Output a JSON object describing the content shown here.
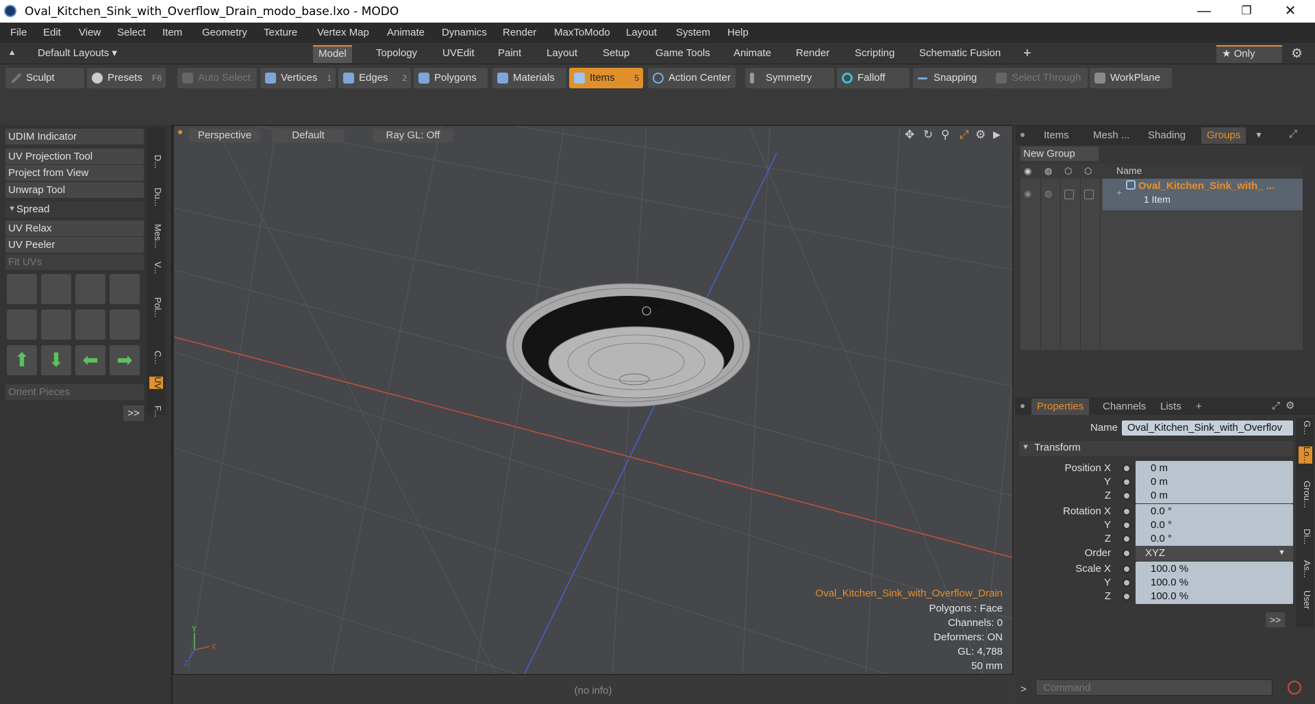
{
  "window": {
    "title": "Oval_Kitchen_Sink_with_Overflow_Drain_modo_base.lxo - MODO",
    "minimize": "—",
    "maximize": "❐",
    "close": "✕"
  },
  "menu": [
    "File",
    "Edit",
    "View",
    "Select",
    "Item",
    "Geometry",
    "Texture",
    "Vertex Map",
    "Animate",
    "Dynamics",
    "Render",
    "MaxToModo",
    "Layout",
    "System",
    "Help"
  ],
  "layout_selector": "Default Layouts ▾",
  "tabs": [
    "Model",
    "Topology",
    "UVEdit",
    "Paint",
    "Layout",
    "Setup",
    "Game Tools",
    "Animate",
    "Render",
    "Scripting",
    "Schematic Fusion"
  ],
  "tab_add": "+",
  "only_button": "★  Only",
  "toolbar": {
    "sculpt": "Sculpt",
    "presets": "Presets",
    "presets_key": "F6",
    "auto_select": "Auto Select",
    "vertices": "Vertices",
    "vertices_num": "1",
    "edges": "Edges",
    "edges_num": "2",
    "polygons": "Polygons",
    "materials": "Materials",
    "items": "Items",
    "items_num": "5",
    "action_center": "Action Center",
    "symmetry": "Symmetry",
    "falloff": "Falloff",
    "snapping": "Snapping",
    "select_through": "Select Through",
    "workplane": "WorkPlane"
  },
  "left_panel": {
    "udim": "UDIM Indicator",
    "uv_projection": "UV Projection Tool",
    "project_from_view": "Project from View",
    "unwrap": "Unwrap Tool",
    "spread": "Spread",
    "uv_relax": "UV Relax",
    "uv_peeler": "UV Peeler",
    "fit_uvs": "Fit UVs",
    "orient_pieces": "Orient Pieces",
    "more": ">>",
    "vtabs": [
      "D...",
      "Du...",
      "Mes...",
      "V...",
      "Pol...",
      "C...",
      "UV",
      "F..."
    ]
  },
  "viewport": {
    "view": "Perspective",
    "shading": "Default",
    "raygl": "Ray GL: Off",
    "item_name": "Oval_Kitchen_Sink_with_Overflow_Drain",
    "polygons": "Polygons : Face",
    "channels": "Channels: 0",
    "deformers": "Deformers: ON",
    "gl": "GL: 4,788",
    "unit": "50 mm",
    "colors": {
      "x_axis": "#c8503a",
      "z_axis": "#4a5fd0",
      "accent": "#e8902a"
    }
  },
  "status": {
    "info": "(no info)"
  },
  "right_panel": {
    "top_tabs": [
      "Items",
      "Mesh ...",
      "Shading",
      "Groups"
    ],
    "new_group": "New Group",
    "col_name": "Name",
    "group_name": "Oval_Kitchen_Sink_with_ ...",
    "group_count": "1 Item",
    "prop_tabs": [
      "Properties",
      "Channels",
      "Lists"
    ],
    "prop_add": "+",
    "name_label": "Name",
    "name_value": "Oval_Kitchen_Sink_with_Overflov",
    "transform": "Transform",
    "position_x_label": "Position X",
    "y_label": "Y",
    "z_label": "Z",
    "position": [
      "0 m",
      "0 m",
      "0 m"
    ],
    "rotation_x_label": "Rotation X",
    "rotation": [
      "0.0 °",
      "0.0 °",
      "0.0 °"
    ],
    "order_label": "Order",
    "order_value": "XYZ",
    "scale_x_label": "Scale X",
    "scale": [
      "100.0 %",
      "100.0 %",
      "100.0 %"
    ],
    "more": ">>",
    "command_prompt": ">",
    "command_placeholder": "Command",
    "rvtabs": [
      "G...",
      "Lo...",
      "Grou...",
      "Di...",
      "As...",
      "User"
    ]
  }
}
